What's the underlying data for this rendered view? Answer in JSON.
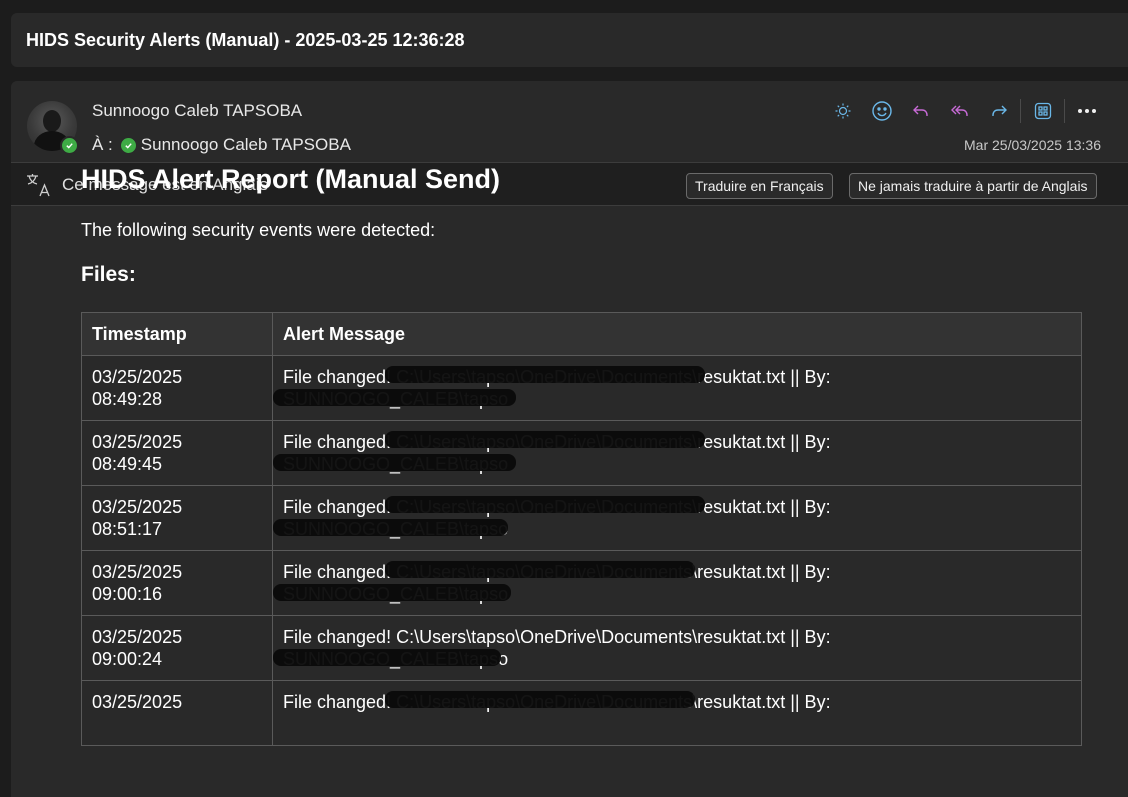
{
  "subject": "HIDS Security Alerts (Manual) - 2025-03-25 12:36:28",
  "header": {
    "sender_name": "Sunnoogo Caleb TAPSOBA",
    "to_label": "À :",
    "recipient_name": "Sunnoogo Caleb TAPSOBA",
    "date": "Mar 25/03/2025 13:36",
    "actions": [
      "summary-icon",
      "emoji-icon",
      "reply-icon",
      "reply-all-icon",
      "forward-icon",
      "apps-icon",
      "more-icon"
    ],
    "action_colors": {
      "summary": "#6ab7e8",
      "emoji": "#6ab7e8",
      "reply": "#c76bd6",
      "reply_all": "#c76bd6",
      "forward": "#6ab7e8",
      "apps": "#6ab7e8"
    }
  },
  "translation": {
    "notice": "Ce message est en Anglais",
    "translate_button": "Traduire en Français",
    "never_translate_button": "Ne jamais traduire à partir de Anglais"
  },
  "body": {
    "title": "HIDS Alert Report (Manual Send)",
    "intro": "The following security events were detected:",
    "section_heading": "Files:",
    "table": {
      "columns": [
        "Timestamp",
        "Alert Message"
      ],
      "rows": [
        {
          "date": "03/25/2025",
          "time": "08:49:28",
          "message": "File changed! C:\\Users\\tapso\\OneDrive\\Documents\\resuktat.txt || By:",
          "user": "SUNNOOGO_CALEB\\tapso"
        },
        {
          "date": "03/25/2025",
          "time": "08:49:45",
          "message": "File changed! C:\\Users\\tapso\\OneDrive\\Documents\\resuktat.txt || By:",
          "user": "SUNNOOGO_CALEB\\tapso"
        },
        {
          "date": "03/25/2025",
          "time": "08:51:17",
          "message": "File changed! C:\\Users\\tapso\\OneDrive\\Documents\\resuktat.txt || By:",
          "user": "SUNNOOGO_CALEB\\tapso"
        },
        {
          "date": "03/25/2025",
          "time": "09:00:16",
          "message": "File changed! C:\\Users\\tapso\\OneDrive\\Documents\\resuktat.txt || By:",
          "user": "SUNNOOGO_CALEB\\tapso"
        },
        {
          "date": "03/25/2025",
          "time": "09:00:24",
          "message": "File changed! C:\\Users\\tapso\\OneDrive\\Documents\\resuktat.txt || By:",
          "user": "SUNNOOGO_CALEB\\tapso"
        },
        {
          "date": "03/25/2025",
          "time": "",
          "message": "File changed! C:\\Users\\tapso\\OneDrive\\Documents\\resuktat.txt || By:",
          "user": ""
        }
      ]
    }
  }
}
